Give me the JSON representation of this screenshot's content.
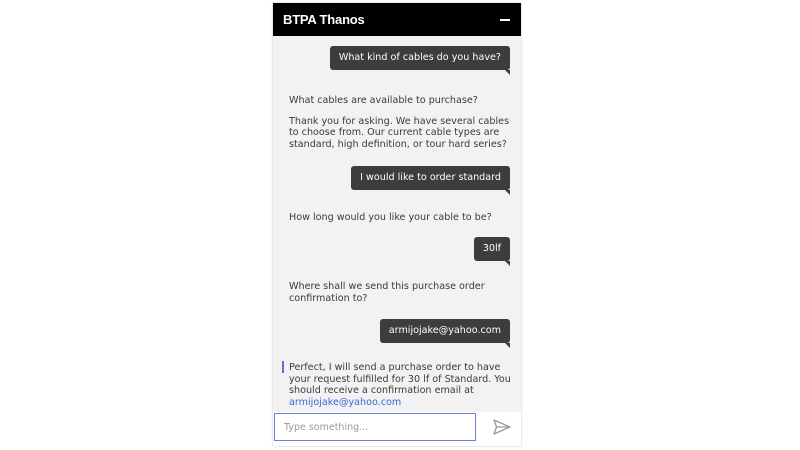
{
  "header": {
    "title": "BTPA Thanos",
    "minimize_icon": "minus-icon"
  },
  "messages": [
    {
      "role": "user",
      "text": "What kind of cables do you have?"
    },
    {
      "role": "bot",
      "paragraphs": [
        "What cables are available to purchase?",
        "Thank you for asking. We have several cables to choose from. Our current cable types are standard, high definition, or tour hard series?"
      ]
    },
    {
      "role": "user",
      "text": "I would like to order standard"
    },
    {
      "role": "bot",
      "paragraphs": [
        "How long would you like your cable to be?"
      ]
    },
    {
      "role": "user",
      "text": "30lf"
    },
    {
      "role": "bot",
      "paragraphs": [
        "Where shall we send this purchase order confirmation to?"
      ]
    },
    {
      "role": "user",
      "text": "armijojake@yahoo.com"
    },
    {
      "role": "bot",
      "text_before_link": "Perfect, I will send a purchase order to have your request fulfilled for 30 lf of Standard. You should receive a confirmation email at",
      "link": "armijojake@yahoo.com"
    }
  ],
  "composer": {
    "placeholder": "Type something...",
    "value": "",
    "send_icon": "send-icon"
  },
  "colors": {
    "header_bg": "#000000",
    "window_bg": "#f2f2f2",
    "user_bubble": "#3d3d3d",
    "link": "#3b66d8",
    "focus_accent": "#6a7ee0"
  }
}
